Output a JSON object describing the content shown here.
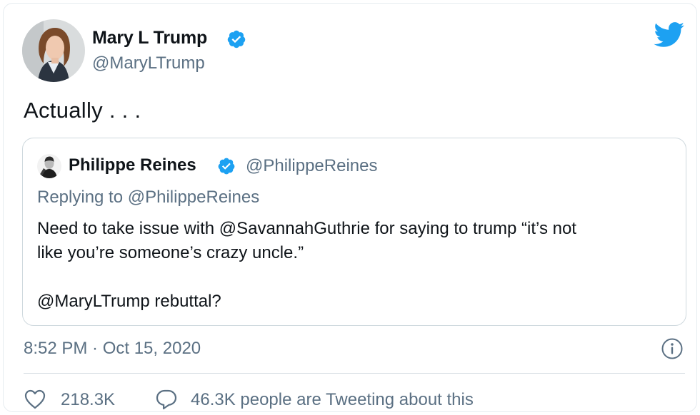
{
  "tweet": {
    "author": {
      "name": "Mary L Trump",
      "handle": "@MaryLTrump",
      "verified": true
    },
    "text": "Actually . . .",
    "timestamp": "8:52 PM · Oct 15, 2020",
    "stats": {
      "likes": "218.3K",
      "tweeting": "46.3K people are Tweeting about this"
    },
    "quoted": {
      "author": {
        "name": "Philippe Reines",
        "handle": "@PhilippeReines",
        "verified": true
      },
      "replying_to": "Replying to @PhilippeReines",
      "body_line1": "Need to take issue with @SavannahGuthrie for saying to trump “it’s not",
      "body_line2": "like you’re someone’s crazy uncle.”",
      "body_line3": "@MaryLTrump rebuttal?"
    }
  },
  "icons": {
    "logo": "twitter-bird-icon",
    "verified": "verified-badge-icon",
    "info": "info-icon",
    "like": "heart-icon",
    "reply": "speech-bubble-icon"
  },
  "colors": {
    "accent": "#1da1f2",
    "secondary_text": "#5b7083",
    "border": "#cfd9de"
  }
}
